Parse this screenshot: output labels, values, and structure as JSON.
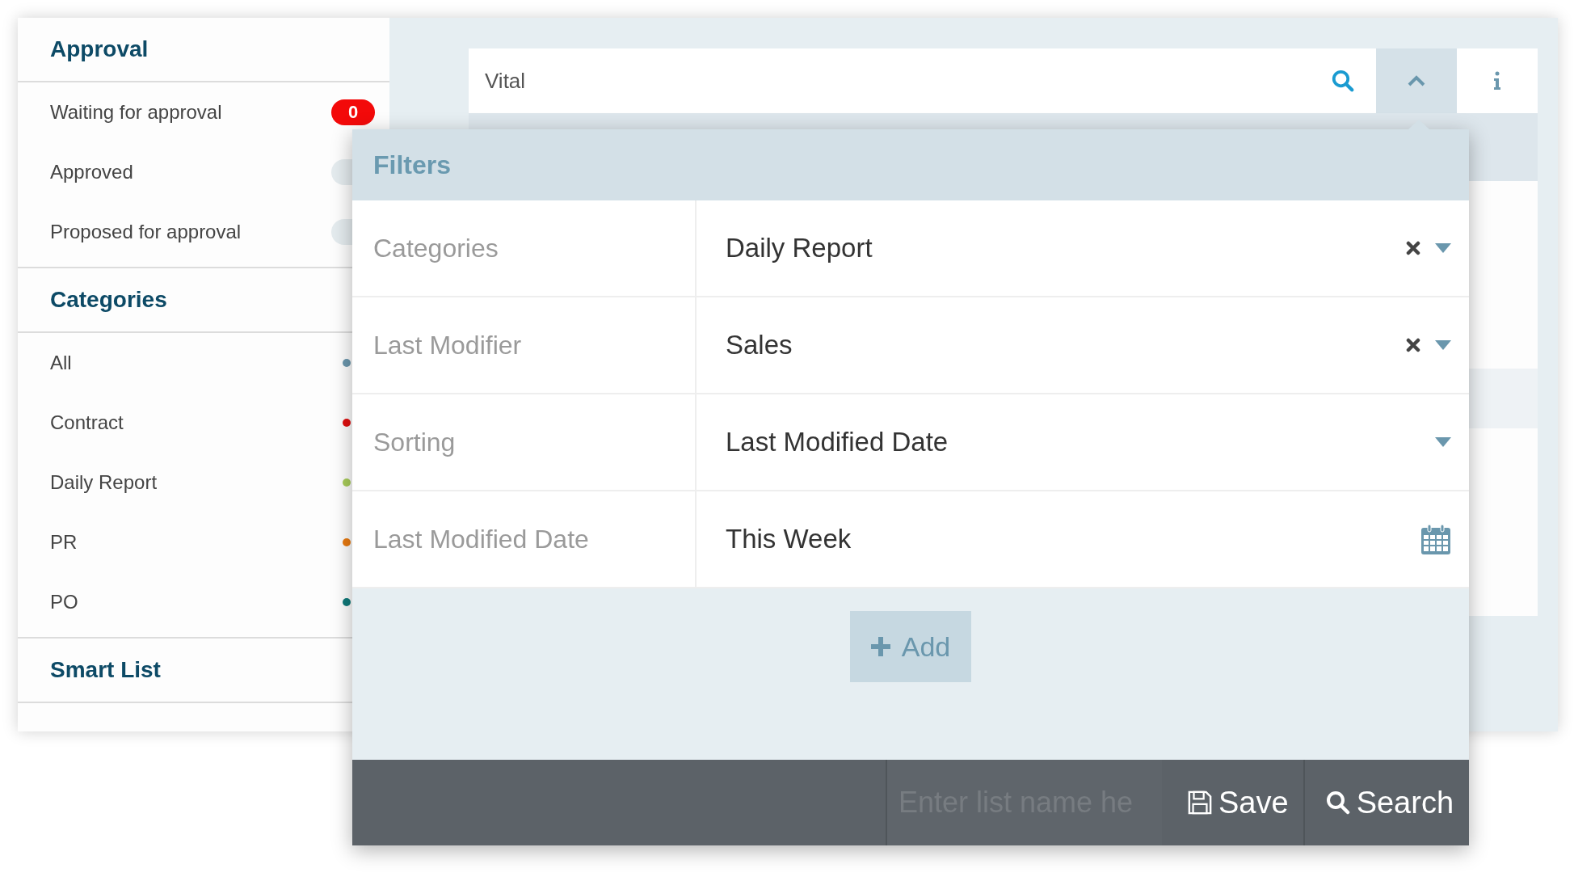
{
  "sidebar": {
    "sections": [
      {
        "title": "Approval",
        "items": [
          {
            "label": "Waiting for approval",
            "kind": "badge",
            "count": "0",
            "highlighted": true
          },
          {
            "label": "Approved",
            "kind": "badge",
            "highlighted": false
          },
          {
            "label": "Proposed for approval",
            "kind": "badge",
            "highlighted": false
          }
        ]
      },
      {
        "title": "Categories",
        "items": [
          {
            "label": "All",
            "kind": "dot",
            "color": "#6b97ad"
          },
          {
            "label": "Contract",
            "kind": "dot",
            "color": "#e01010"
          },
          {
            "label": "Daily Report",
            "kind": "dot",
            "color": "#a8cc5a"
          },
          {
            "label": "PR",
            "kind": "dot",
            "color": "#e87a10"
          },
          {
            "label": "PO",
            "kind": "dot",
            "color": "#117a7a"
          }
        ]
      },
      {
        "title": "Smart List"
      }
    ]
  },
  "search": {
    "value": "Vital",
    "expanded": true
  },
  "filters": {
    "title": "Filters",
    "rows": [
      {
        "label": "Categories",
        "value": "Daily Report",
        "kind": "select",
        "clearable": true
      },
      {
        "label": "Last Modifier",
        "value": "Sales",
        "kind": "select",
        "clearable": true
      },
      {
        "label": "Sorting",
        "value": "Last Modified Date",
        "kind": "select",
        "clearable": false
      },
      {
        "label": "Last Modified Date",
        "value": "This Week",
        "kind": "date"
      }
    ],
    "add_button": "Add"
  },
  "footer": {
    "placeholder": "Enter list name he",
    "save_button": "Save",
    "search_button": "Search"
  }
}
